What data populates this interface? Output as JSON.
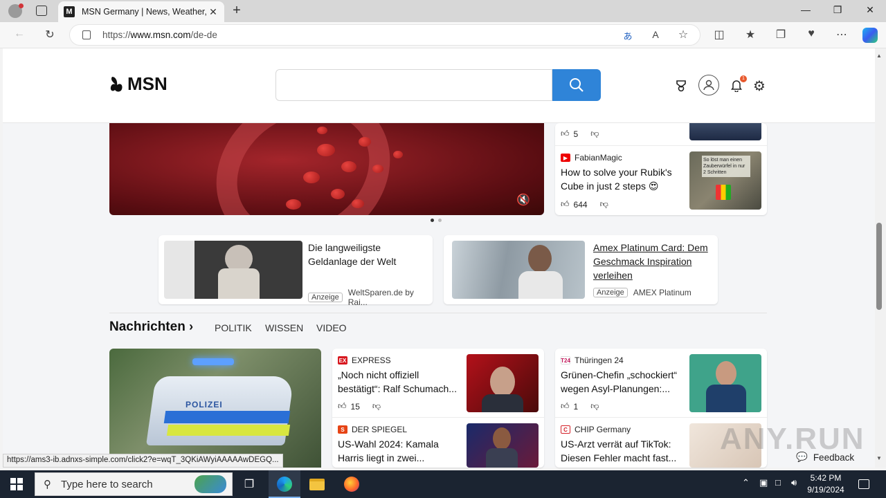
{
  "browser": {
    "tab_title": "MSN Germany | News, Weather, Wea",
    "url_prefix": "https://",
    "url_host": "www.msn.com",
    "url_path": "/de-de",
    "new_tab_symbol": "+",
    "close_symbol": "✕"
  },
  "msn": {
    "logo_text": "MSN",
    "notification_count": "1"
  },
  "trending": [
    {
      "likes": "5"
    },
    {
      "source": "FabianMagic",
      "title": "How to solve your Rubik's Cube in just 2 steps 😍",
      "likes": "644"
    }
  ],
  "thumb_text": "So löst man einen Zauberwürfel in nur 2 Schritten",
  "ads": [
    {
      "title": "Die langweiligste Geldanlage der Welt",
      "badge": "Anzeige",
      "advertiser": "WeltSparen.de by Rai..."
    },
    {
      "title": " Amex Platinum Card: Dem Geschmack Inspiration verleihen ",
      "badge": "Anzeige",
      "advertiser": "AMEX Platinum"
    }
  ],
  "news_section": {
    "title": "Nachrichten",
    "tabs": [
      "POLITIK",
      "WISSEN",
      "VIDEO"
    ]
  },
  "news": [
    {
      "source": "EXPRESS",
      "title": "„Noch nicht offiziell bestätigt“: Ralf Schumach...",
      "likes": "15"
    },
    {
      "source": "DER SPIEGEL",
      "title": "US-Wahl 2024: Kamala Harris liegt in zwei..."
    },
    {
      "source": "Thüringen 24",
      "title": "Grünen-Chefin „schockiert“ wegen Asyl-Planungen:...",
      "likes": "1"
    },
    {
      "source": "CHIP Germany",
      "title": "US-Arzt verrät auf TikTok: Diesen Fehler macht fast..."
    }
  ],
  "police_car_text": "POLIZEI",
  "status_url": "https://ams3-ib.adnxs-simple.com/click2?e=wqT_3QKiAWyiAAAAAwDEGQ...",
  "feedback_label": "Feedback",
  "watermark": "ANY.RUN",
  "taskbar": {
    "search_placeholder": "Type here to search",
    "time": "5:42 PM",
    "date": "9/19/2024"
  }
}
